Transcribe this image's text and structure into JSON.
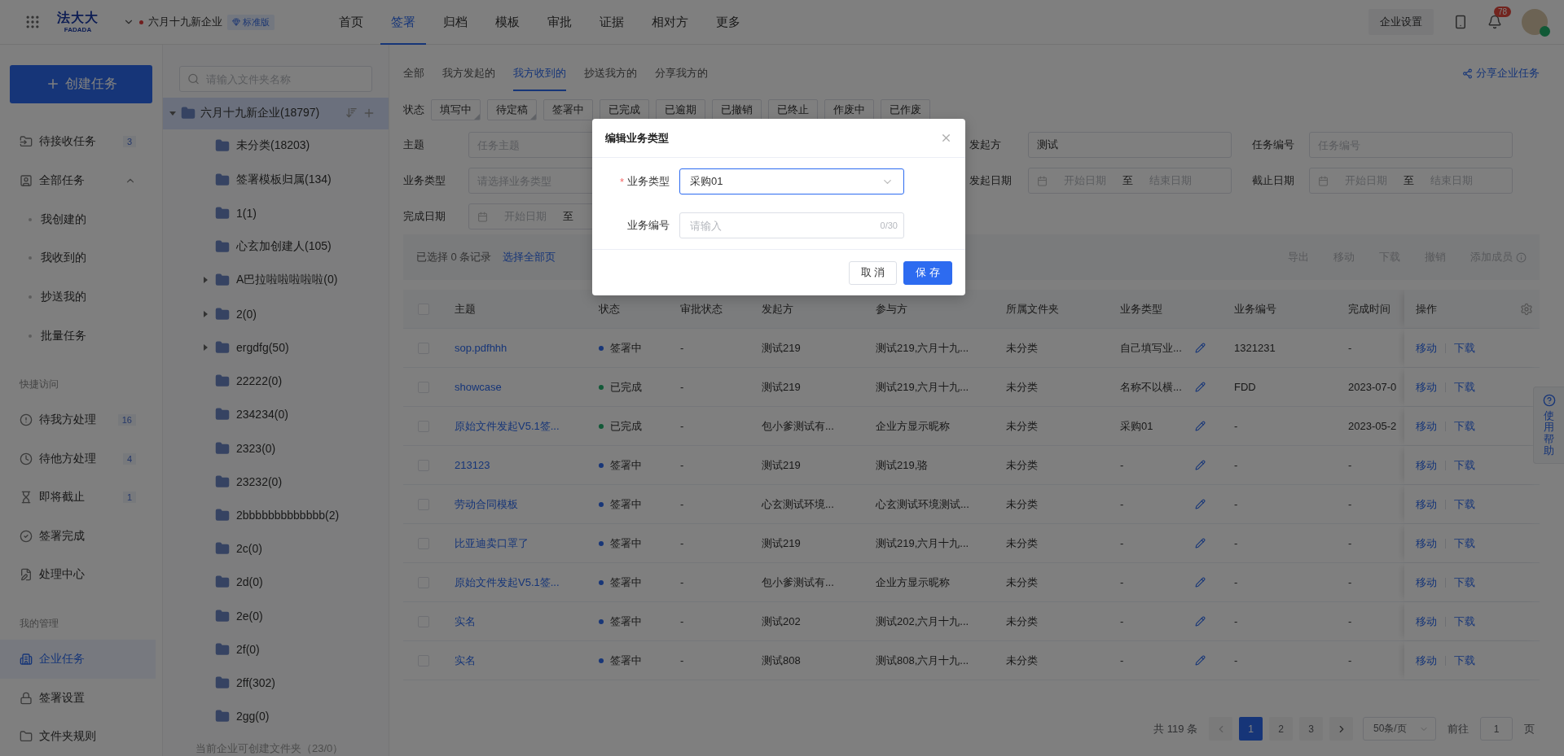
{
  "topbar": {
    "logo_text": "法大大",
    "logo_subtext": "FADADA",
    "company": "六月十九新企业",
    "edition": "标准版",
    "nav": [
      {
        "label": "首页",
        "selected": false
      },
      {
        "label": "签署",
        "selected": true
      },
      {
        "label": "归档",
        "selected": false
      },
      {
        "label": "模板",
        "selected": false
      },
      {
        "label": "审批",
        "selected": false
      },
      {
        "label": "证据",
        "selected": false
      },
      {
        "label": "相对方",
        "selected": false
      },
      {
        "label": "更多",
        "selected": false
      }
    ],
    "settings_button": "企业设置",
    "notification_count": "78"
  },
  "sidebar": {
    "create_button": "创建任务",
    "groups": [
      {
        "items": [
          {
            "label": "待接收任务",
            "count": "3",
            "selected": false
          },
          {
            "label": "全部任务",
            "selected": false,
            "expanded": true,
            "children": [
              {
                "label": "我创建的",
                "selected": false
              },
              {
                "label": "我收到的",
                "selected": false
              },
              {
                "label": "抄送我的",
                "selected": false
              },
              {
                "label": "批量任务",
                "selected": false
              }
            ]
          }
        ]
      },
      {
        "title": "快捷访问",
        "items": [
          {
            "label": "待我方处理",
            "count": "16",
            "selected": false
          },
          {
            "label": "待他方处理",
            "count": "4",
            "selected": false
          },
          {
            "label": "即将截止",
            "count": "1",
            "selected": false
          },
          {
            "label": "签署完成",
            "selected": false
          },
          {
            "label": "处理中心",
            "selected": false
          }
        ]
      },
      {
        "title": "我的管理",
        "items": [
          {
            "label": "企业任务",
            "selected": true
          },
          {
            "label": "签署设置",
            "selected": false
          },
          {
            "label": "文件夹规则",
            "selected": false
          }
        ]
      }
    ]
  },
  "folders": {
    "search": {
      "placeholder": "请输入文件夹名称"
    },
    "root": {
      "label": "六月十九新企业(18797)",
      "expanded": true,
      "selected": true,
      "children": [
        {
          "label": "未分类(18203)",
          "has_children": false
        },
        {
          "label": "签署模板归属(134)",
          "has_children": false
        },
        {
          "label": "1(1)",
          "has_children": false
        },
        {
          "label": "心玄加创建人(105)",
          "has_children": false
        },
        {
          "label": "A巴拉啦啦啦啦啦(0)",
          "has_children": true
        },
        {
          "label": "2(0)",
          "has_children": true
        },
        {
          "label": "ergdfg(50)",
          "has_children": true
        },
        {
          "label": "22222(0)",
          "has_children": false
        },
        {
          "label": "234234(0)",
          "has_children": false
        },
        {
          "label": "2323(0)",
          "has_children": false
        },
        {
          "label": "23232(0)",
          "has_children": false
        },
        {
          "label": "2bbbbbbbbbbbbb(2)",
          "has_children": false
        },
        {
          "label": "2c(0)",
          "has_children": false
        },
        {
          "label": "2d(0)",
          "has_children": false
        },
        {
          "label": "2e(0)",
          "has_children": false
        },
        {
          "label": "2f(0)",
          "has_children": false
        },
        {
          "label": "2ff(302)",
          "has_children": false
        },
        {
          "label": "2gg(0)",
          "has_children": false
        }
      ]
    },
    "footer": "当前企业可创建文件夹（23/0）"
  },
  "tabs": [
    {
      "label": "全部",
      "selected": false
    },
    {
      "label": "我方发起的",
      "selected": false
    },
    {
      "label": "我方收到的",
      "selected": true
    },
    {
      "label": "抄送我方的",
      "selected": false
    },
    {
      "label": "分享我方的",
      "selected": false
    }
  ],
  "share_link": "分享企业任务",
  "status_filter": {
    "label": "状态",
    "chips": [
      {
        "label": "填写中",
        "selected": true
      },
      {
        "label": "待定稿",
        "selected": true
      },
      {
        "label": "签署中",
        "selected": false
      },
      {
        "label": "已完成",
        "selected": false
      },
      {
        "label": "已逾期",
        "selected": false
      },
      {
        "label": "已撤销",
        "selected": false
      },
      {
        "label": "已终止",
        "selected": false
      },
      {
        "label": "作废中",
        "selected": false
      },
      {
        "label": "已作废",
        "selected": false
      }
    ]
  },
  "filter_rows": [
    [
      {
        "kind": "text",
        "label": "主题",
        "placeholder": "任务主题"
      },
      {
        "kind": "text",
        "label": "发起方",
        "value": "测试"
      },
      {
        "kind": "text",
        "label": "任务编号",
        "placeholder": "任务编号"
      }
    ],
    [
      {
        "kind": "text",
        "label": "业务类型",
        "placeholder": "请选择业务类型"
      },
      {
        "kind": "daterange",
        "label": "发起日期",
        "start_placeholder": "开始日期",
        "separator": "至",
        "end_placeholder": "结束日期"
      },
      {
        "kind": "daterange",
        "label": "截止日期",
        "start_placeholder": "开始日期",
        "separator": "至",
        "end_placeholder": "结束日期"
      }
    ],
    [
      {
        "kind": "daterange",
        "label": "完成日期",
        "start_placeholder": "开始日期",
        "separator": "至"
      }
    ]
  ],
  "toolbar": {
    "selected_info": "已选择 0 条记录",
    "select_all": "选择全部页",
    "actions": [
      {
        "label": "导出",
        "disabled": true
      },
      {
        "label": "移动",
        "disabled": true
      },
      {
        "label": "下载",
        "disabled": true
      },
      {
        "label": "撤销",
        "disabled": true
      },
      {
        "label": "添加成员",
        "disabled": true
      }
    ]
  },
  "table": {
    "all_checked": false,
    "columns": [
      "主题",
      "状态",
      "审批状态",
      "发起方",
      "参与方",
      "所属文件夹",
      "业务类型",
      "业务编号",
      "完成时间",
      "操作"
    ],
    "rows": [
      {
        "subject": "sop.pdfhhh",
        "status": "签署中",
        "checked": false,
        "color": "#183678",
        "approval": "-",
        "initiator": "测试219",
        "participants": "测试219,六月十九...",
        "folder": "未分类",
        "biz_type": "自己填写业...",
        "biz_no": "1321231",
        "completed": "-",
        "actions": [
          "移动",
          "下载"
        ]
      },
      {
        "subject": "showcase",
        "status": "已完成",
        "checked": false,
        "color": "#125937",
        "approval": "-",
        "initiator": "测试219",
        "participants": "测试219,六月十九...",
        "folder": "未分类",
        "biz_type": "名称不以横...",
        "biz_no": "FDD",
        "completed": "2023-07-0",
        "actions": [
          "移动",
          "下载"
        ]
      },
      {
        "subject": "原始文件发起V5.1签...",
        "status": "已完成",
        "checked": false,
        "color": "#125937",
        "approval": "-",
        "initiator": "包小爹测试有...",
        "participants": "企业方显示昵称",
        "folder": "未分类",
        "biz_type": "采购01",
        "biz_no": "-",
        "completed": "2023-05-2",
        "actions": [
          "移动",
          "下载"
        ]
      },
      {
        "subject": "213123",
        "status": "签署中",
        "checked": false,
        "color": "#183678",
        "approval": "-",
        "initiator": "测试219",
        "participants": "测试219,骆",
        "folder": "未分类",
        "biz_type": "-",
        "biz_no": "-",
        "completed": "-",
        "actions": [
          "移动",
          "下载"
        ]
      },
      {
        "subject": "劳动合同模板",
        "status": "签署中",
        "checked": false,
        "color": "#183678",
        "approval": "-",
        "initiator": "心玄测试环境...",
        "participants": "心玄测试环境测试...",
        "folder": "未分类",
        "biz_type": "-",
        "biz_no": "-",
        "completed": "-",
        "actions": [
          "移动",
          "下载"
        ]
      },
      {
        "subject": "比亚迪卖口罩了",
        "status": "签署中",
        "checked": false,
        "color": "#183678",
        "approval": "-",
        "initiator": "测试219",
        "participants": "测试219,六月十九...",
        "folder": "未分类",
        "biz_type": "-",
        "biz_no": "-",
        "completed": "-",
        "actions": [
          "移动",
          "下载"
        ]
      },
      {
        "subject": "原始文件发起V5.1签...",
        "status": "签署中",
        "checked": false,
        "color": "#183678",
        "approval": "-",
        "initiator": "包小爹测试有...",
        "participants": "企业方显示昵称",
        "folder": "未分类",
        "biz_type": "-",
        "biz_no": "-",
        "completed": "-",
        "actions": [
          "移动",
          "下载"
        ]
      },
      {
        "subject": "实名",
        "status": "签署中",
        "checked": false,
        "color": "#183678",
        "approval": "-",
        "initiator": "测试202",
        "participants": "测试202,六月十九...",
        "folder": "未分类",
        "biz_type": "-",
        "biz_no": "-",
        "completed": "-",
        "actions": [
          "移动",
          "下载"
        ]
      },
      {
        "subject": "实名",
        "status": "签署中",
        "checked": false,
        "color": "#183678",
        "approval": "-",
        "initiator": "测试808",
        "participants": "测试808,六月十九...",
        "folder": "未分类",
        "biz_type": "-",
        "biz_no": "-",
        "completed": "-",
        "actions": [
          "移动",
          "下载"
        ]
      }
    ]
  },
  "pagination": {
    "total": "共 119 条",
    "pages": [
      {
        "label": "1",
        "selected": true
      },
      {
        "label": "2",
        "selected": false
      },
      {
        "label": "3",
        "selected": false
      }
    ],
    "page_size": "50条/页",
    "goto_label": "前往",
    "goto_value": "1",
    "goto_suffix": "页"
  },
  "help_tab": "使用帮助",
  "dialog": {
    "title": "编辑业务类型",
    "required_symbol": "*",
    "fields": [
      {
        "kind": "select",
        "label": "业务类型",
        "required": true,
        "value": "采购01"
      },
      {
        "kind": "input",
        "label": "业务编号",
        "required": false,
        "placeholder": "请输入",
        "counter": "0/30"
      }
    ],
    "buttons": [
      {
        "kind": "secondary",
        "label": "取 消"
      },
      {
        "kind": "primary",
        "label": "保 存"
      }
    ]
  }
}
